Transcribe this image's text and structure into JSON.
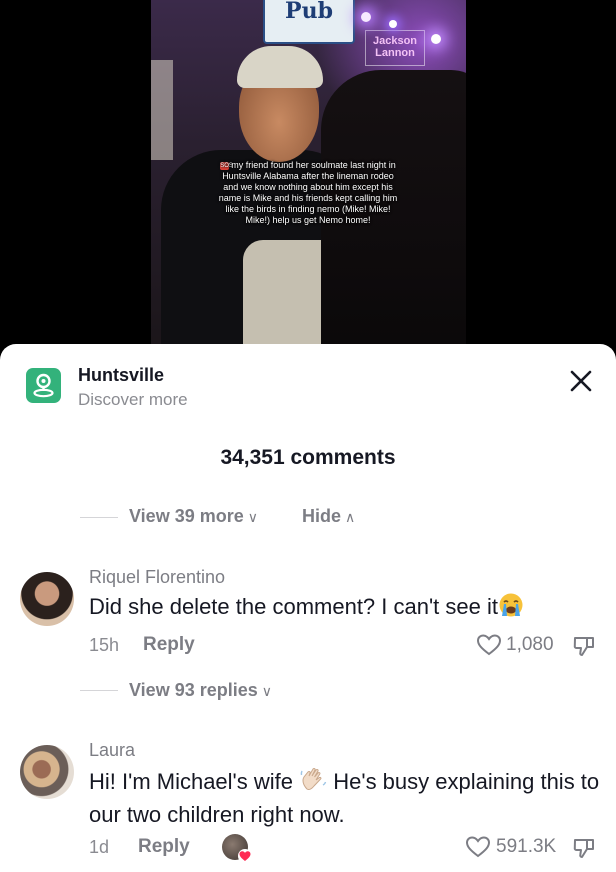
{
  "video": {
    "caption": "my friend found her soulmate last night in Huntsville Alabama after the lineman rodeo and we know nothing about him except his name is Mike and his friends kept calling him like the birds in finding nemo (Mike! Mike! Mike!) help us get Nemo home!",
    "sign_text": "Pub",
    "banner_text": "Jackson Lannon"
  },
  "location": {
    "name": "Huntsville",
    "subtitle": "Discover more",
    "icon": "location-pin-icon"
  },
  "comments_header": {
    "count_label": "34,351 comments"
  },
  "thread_controls": {
    "view_more_label": "View 39 more",
    "hide_label": "Hide",
    "view_replies_label": "View 93 replies"
  },
  "comments": [
    {
      "author": "Riquel Florentino",
      "text": "Did she delete the comment? I can't see it",
      "emoji": "crying-face",
      "time": "15h",
      "reply_label": "Reply",
      "likes": "1,080"
    },
    {
      "author": "Laura",
      "text_part1": "Hi! I'm Michael's wife",
      "emoji": "waving-hand",
      "text_part2": "He's busy explaining this to our two children right now.",
      "time": "1d",
      "reply_label": "Reply",
      "likes": "591.3K",
      "liked_by_creator": true
    }
  ],
  "colors": {
    "sheet_bg": "#ffffff",
    "primary_text": "#161823",
    "secondary_text": "#7c7d84",
    "location_icon_bg": "#33b27b",
    "creator_heart": "#fe2c55"
  }
}
